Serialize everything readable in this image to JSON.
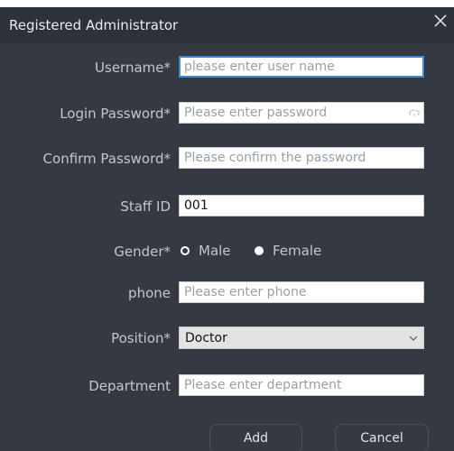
{
  "dialog": {
    "title": "Registered Administrator",
    "close_icon": "close-icon"
  },
  "form": {
    "username": {
      "label": "Username*",
      "placeholder": "please enter user name",
      "value": ""
    },
    "login_password": {
      "label": "Login Password*",
      "placeholder": "Please enter password",
      "value": ""
    },
    "confirm_password": {
      "label": "Confirm Password*",
      "placeholder": "Please confirm the password",
      "value": ""
    },
    "staff_id": {
      "label": "Staff ID",
      "placeholder": "",
      "value": "001"
    },
    "gender": {
      "label": "Gender*",
      "options": [
        "Male",
        "Female"
      ],
      "selected": "Male"
    },
    "phone": {
      "label": "phone",
      "placeholder": "Please enter phone",
      "value": ""
    },
    "position": {
      "label": "Position*",
      "selected": "Doctor"
    },
    "department": {
      "label": "Department",
      "placeholder": "Please enter department",
      "value": ""
    }
  },
  "buttons": {
    "add": "Add",
    "cancel": "Cancel"
  },
  "colors": {
    "dialog_bg": "#353a42",
    "titlebar_bg": "#2d323a",
    "focus_border": "#3f8bd8",
    "label_text": "#c3c7cd"
  }
}
